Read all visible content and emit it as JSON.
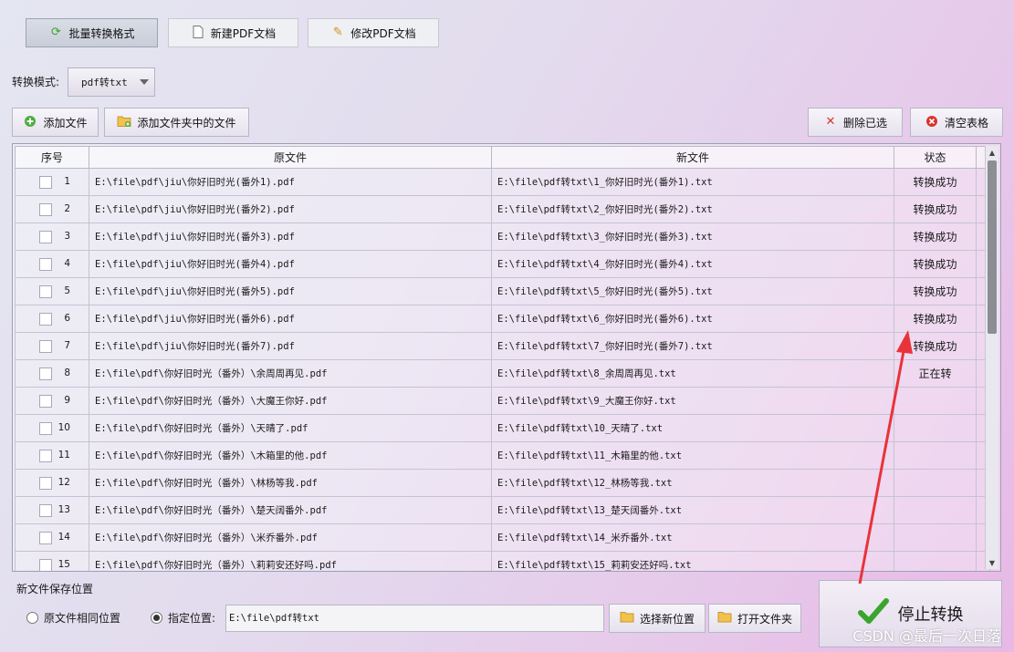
{
  "toolbar": {
    "batch_convert": "批量转换格式",
    "new_pdf": "新建PDF文档",
    "edit_pdf": "修改PDF文档"
  },
  "mode": {
    "label": "转换模式:",
    "value": "pdf转txt"
  },
  "actions": {
    "add_file": "添加文件",
    "add_folder": "添加文件夹中的文件",
    "delete_selected": "删除已选",
    "clear_table": "清空表格"
  },
  "table": {
    "headers": [
      "序号",
      "原文件",
      "新文件",
      "状态"
    ],
    "rows": [
      {
        "idx": "1",
        "src": "E:\\file\\pdf\\jiu\\你好旧时光(番外1).pdf",
        "dst": "E:\\file\\pdf转txt\\1_你好旧时光(番外1).txt",
        "status": "转换成功"
      },
      {
        "idx": "2",
        "src": "E:\\file\\pdf\\jiu\\你好旧时光(番外2).pdf",
        "dst": "E:\\file\\pdf转txt\\2_你好旧时光(番外2).txt",
        "status": "转换成功"
      },
      {
        "idx": "3",
        "src": "E:\\file\\pdf\\jiu\\你好旧时光(番外3).pdf",
        "dst": "E:\\file\\pdf转txt\\3_你好旧时光(番外3).txt",
        "status": "转换成功"
      },
      {
        "idx": "4",
        "src": "E:\\file\\pdf\\jiu\\你好旧时光(番外4).pdf",
        "dst": "E:\\file\\pdf转txt\\4_你好旧时光(番外4).txt",
        "status": "转换成功"
      },
      {
        "idx": "5",
        "src": "E:\\file\\pdf\\jiu\\你好旧时光(番外5).pdf",
        "dst": "E:\\file\\pdf转txt\\5_你好旧时光(番外5).txt",
        "status": "转换成功"
      },
      {
        "idx": "6",
        "src": "E:\\file\\pdf\\jiu\\你好旧时光(番外6).pdf",
        "dst": "E:\\file\\pdf转txt\\6_你好旧时光(番外6).txt",
        "status": "转换成功"
      },
      {
        "idx": "7",
        "src": "E:\\file\\pdf\\jiu\\你好旧时光(番外7).pdf",
        "dst": "E:\\file\\pdf转txt\\7_你好旧时光(番外7).txt",
        "status": "转换成功"
      },
      {
        "idx": "8",
        "src": "E:\\file\\pdf\\你好旧时光（番外）\\余周周再见.pdf",
        "dst": "E:\\file\\pdf转txt\\8_余周周再见.txt",
        "status": "正在转"
      },
      {
        "idx": "9",
        "src": "E:\\file\\pdf\\你好旧时光（番外）\\大魔王你好.pdf",
        "dst": "E:\\file\\pdf转txt\\9_大魔王你好.txt",
        "status": ""
      },
      {
        "idx": "10",
        "src": "E:\\file\\pdf\\你好旧时光（番外）\\天晴了.pdf",
        "dst": "E:\\file\\pdf转txt\\10_天晴了.txt",
        "status": ""
      },
      {
        "idx": "11",
        "src": "E:\\file\\pdf\\你好旧时光（番外）\\木箱里的他.pdf",
        "dst": "E:\\file\\pdf转txt\\11_木箱里的他.txt",
        "status": ""
      },
      {
        "idx": "12",
        "src": "E:\\file\\pdf\\你好旧时光（番外）\\林杨等我.pdf",
        "dst": "E:\\file\\pdf转txt\\12_林杨等我.txt",
        "status": ""
      },
      {
        "idx": "13",
        "src": "E:\\file\\pdf\\你好旧时光（番外）\\楚天阔番外.pdf",
        "dst": "E:\\file\\pdf转txt\\13_楚天阔番外.txt",
        "status": ""
      },
      {
        "idx": "14",
        "src": "E:\\file\\pdf\\你好旧时光（番外）\\米乔番外.pdf",
        "dst": "E:\\file\\pdf转txt\\14_米乔番外.txt",
        "status": ""
      },
      {
        "idx": "15",
        "src": "E:\\file\\pdf\\你好旧时光（番外）\\莉莉安还好吗.pdf",
        "dst": "E:\\file\\pdf转txt\\15_莉莉安还好吗.txt",
        "status": ""
      }
    ]
  },
  "save": {
    "title": "新文件保存位置",
    "same_location": "原文件相同位置",
    "specified": "指定位置:",
    "path": "E:\\file\\pdf转txt",
    "choose_new": "选择新位置",
    "open_folder": "打开文件夹"
  },
  "stop_button": "停止转换",
  "watermark": "CSDN @最后一次日落",
  "colors": {
    "annotation_arrow": "#e8333a",
    "success_check": "#3aa52c",
    "delete_red": "#d9332b"
  }
}
